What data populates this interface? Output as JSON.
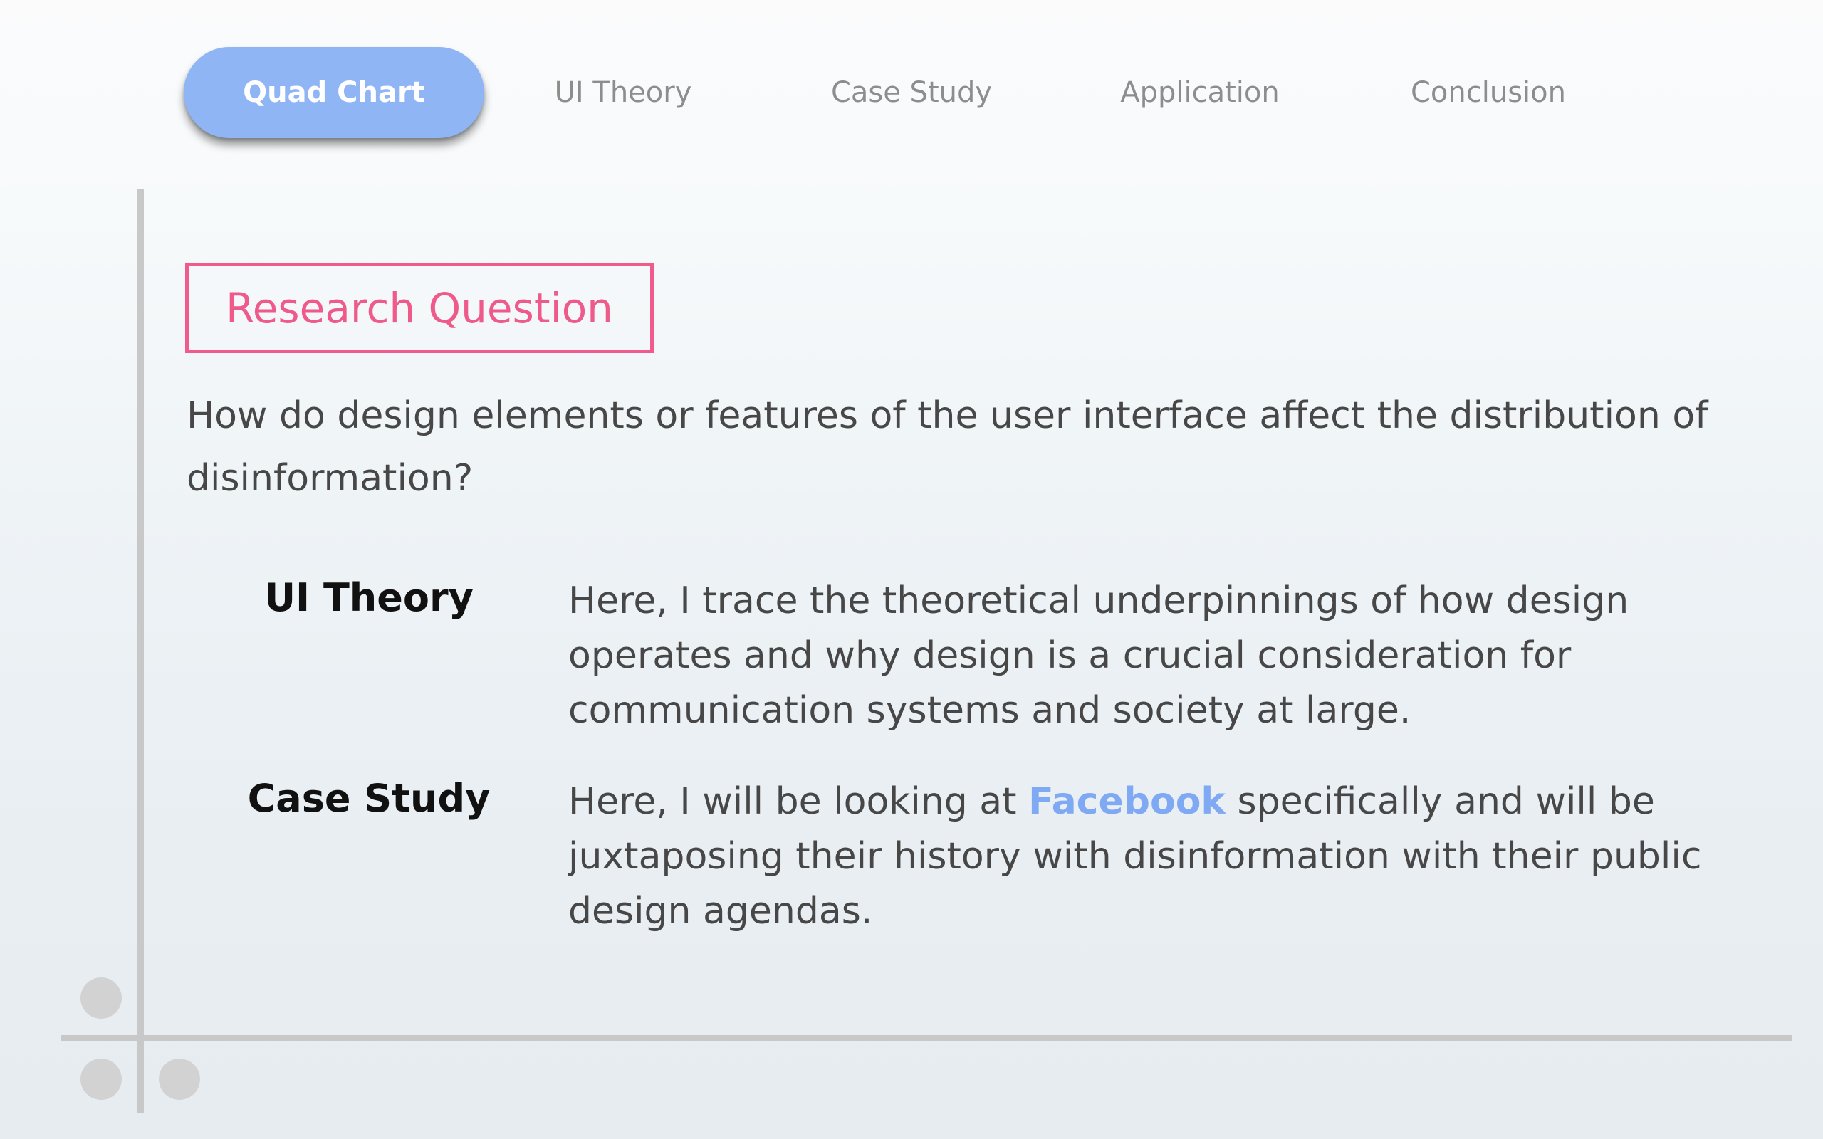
{
  "nav": {
    "tabs": [
      {
        "label": "Quad Chart",
        "active": true
      },
      {
        "label": "UI Theory",
        "active": false
      },
      {
        "label": "Case Study",
        "active": false
      },
      {
        "label": "Application",
        "active": false
      },
      {
        "label": "Conclusion",
        "active": false
      }
    ]
  },
  "research": {
    "heading": "Research Question",
    "question": "How do design elements or features of the user interface affect the distribution of disinformation?"
  },
  "rows": [
    {
      "label": "UI Theory",
      "text": "Here, I trace the theoretical underpinnings of how design operates and why design is a crucial consideration for communication systems and society at large."
    },
    {
      "label": "Case Study",
      "text_before": "Here, I will be looking at ",
      "link": "Facebook",
      "text_after": " specifically and will be juxtaposing their history with disinformation with their public design agendas."
    }
  ],
  "colors": {
    "active_tab": "#8fb5f5",
    "heading_border": "#f05b8c",
    "link": "#7fa9f2",
    "frame_lines": "#c8c8c8"
  }
}
